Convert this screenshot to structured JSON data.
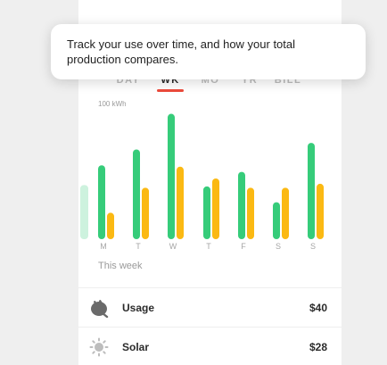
{
  "tabs": [
    {
      "label": "DAY",
      "active": false
    },
    {
      "label": "WK",
      "active": true
    },
    {
      "label": "MO",
      "active": false
    },
    {
      "label": "YR",
      "active": false
    },
    {
      "label": "BILL",
      "active": false
    }
  ],
  "colors": {
    "usage": "#36cc7a",
    "solar": "#fbb913",
    "accent": "#ec4a3b"
  },
  "chart_data": {
    "type": "bar",
    "unit_label": "100 kWh",
    "categories": [
      "M",
      "T",
      "W",
      "T",
      "F",
      "S",
      "S"
    ],
    "ylim": [
      0,
      100
    ],
    "series": [
      {
        "values": [
          56,
          68,
          95,
          40,
          51,
          28,
          73
        ]
      },
      {
        "values": [
          20,
          39,
          55,
          46,
          39,
          39,
          42
        ]
      }
    ],
    "previous_day_partial": {
      "value": 41
    }
  },
  "period_label": "This week",
  "summary": [
    {
      "label": "Usage",
      "amount": "$40",
      "icon": "plug-icon"
    },
    {
      "label": "Solar",
      "amount": "$28",
      "icon": "sun-icon"
    }
  ],
  "tooltip": {
    "text": "Track your use over time, and how your total production compares."
  }
}
